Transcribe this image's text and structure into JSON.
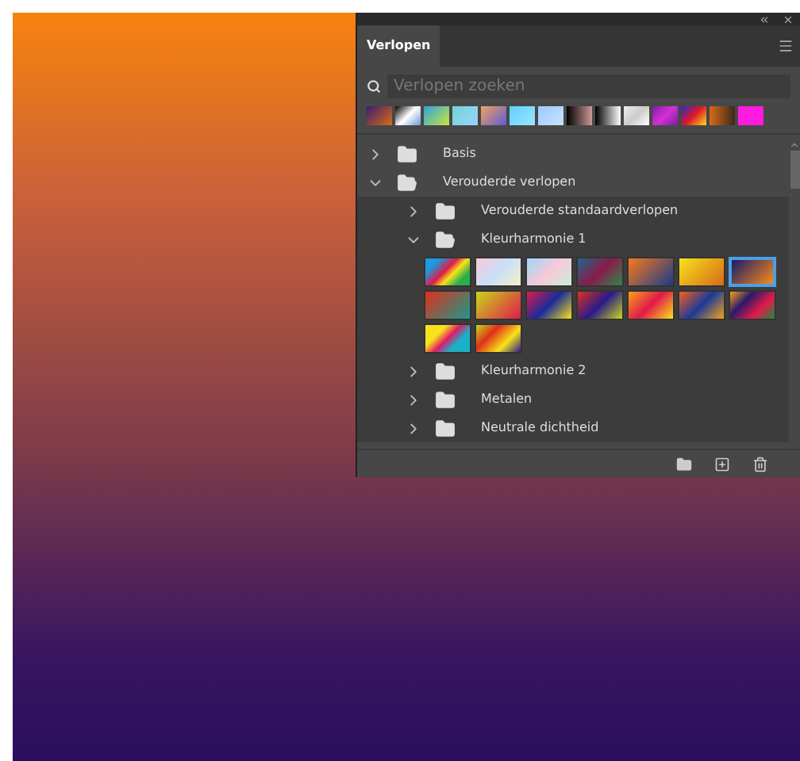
{
  "panel": {
    "tab": {
      "label": "Verlopen",
      "selected": true
    },
    "search": {
      "placeholder": "Verlopen zoeken"
    }
  },
  "tree": [
    {
      "label": "Basis",
      "expanded": false
    },
    {
      "label": "Verouderde verlopen",
      "expanded": true,
      "children": [
        {
          "label": "Verouderde standaardverlopen",
          "expanded": false
        },
        {
          "label": "Kleurharmonie 1",
          "expanded": true,
          "gradients": [
            {
              "selected": false
            },
            {
              "selected": false
            },
            {
              "selected": false
            },
            {
              "selected": false
            },
            {
              "selected": false
            },
            {
              "selected": false
            },
            {
              "selected": true
            },
            {
              "selected": false
            },
            {
              "selected": false
            },
            {
              "selected": false
            },
            {
              "selected": false
            },
            {
              "selected": false
            },
            {
              "selected": false
            },
            {
              "selected": false
            },
            {
              "selected": false
            },
            {
              "selected": false
            }
          ]
        },
        {
          "label": "Kleurharmonie 2",
          "expanded": false
        },
        {
          "label": "Metalen",
          "expanded": false
        },
        {
          "label": "Neutrale dichtheid",
          "expanded": false
        }
      ]
    }
  ]
}
